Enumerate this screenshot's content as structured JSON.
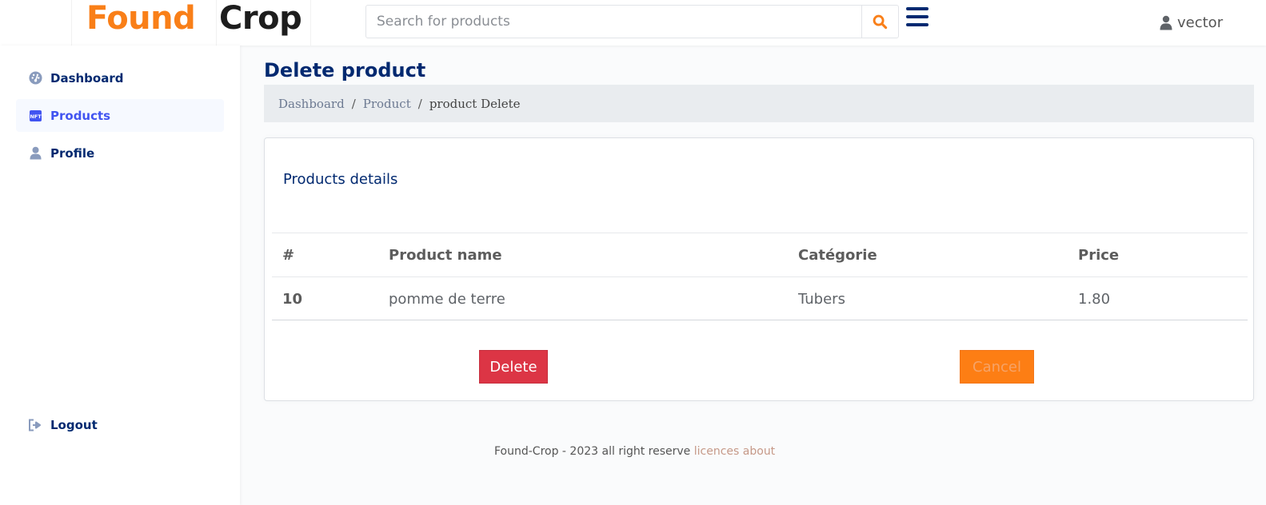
{
  "header": {
    "brand_first": "Found",
    "brand_second": "Crop",
    "search_placeholder": "Search for products",
    "search_icon": "search-icon",
    "menu_icon": "hamburger-icon",
    "user_name": "vector",
    "user_icon": "user-icon"
  },
  "sidebar": {
    "items": [
      {
        "label": "Dashboard",
        "icon": "dashboard-icon",
        "active": false
      },
      {
        "label": "Products",
        "icon": "nft-icon",
        "active": true
      },
      {
        "label": "Profile",
        "icon": "person-icon",
        "active": false
      }
    ],
    "logout": {
      "label": "Logout",
      "icon": "logout-icon"
    }
  },
  "main": {
    "page_title": "Delete product",
    "breadcrumb": [
      "Dashboard",
      "Product",
      "product Delete"
    ],
    "card_title": "Products details",
    "table": {
      "columns": [
        "#",
        "Product name",
        "Catégorie",
        "Price"
      ],
      "rows": [
        {
          "id": "10",
          "name": "pomme de terre",
          "category": "Tubers",
          "price": "1.80"
        }
      ]
    },
    "delete_label": "Delete",
    "cancel_label": "Cancel"
  },
  "footer": {
    "text": "Found-Crop - 2023 all right reserve",
    "link_licences": "licences",
    "link_about": "about"
  },
  "colors": {
    "brand_orange": "#f97f18",
    "navy": "#012970",
    "active_blue": "#4154f1",
    "danger": "#dc3545",
    "cancel_orange": "#fd7e14"
  }
}
